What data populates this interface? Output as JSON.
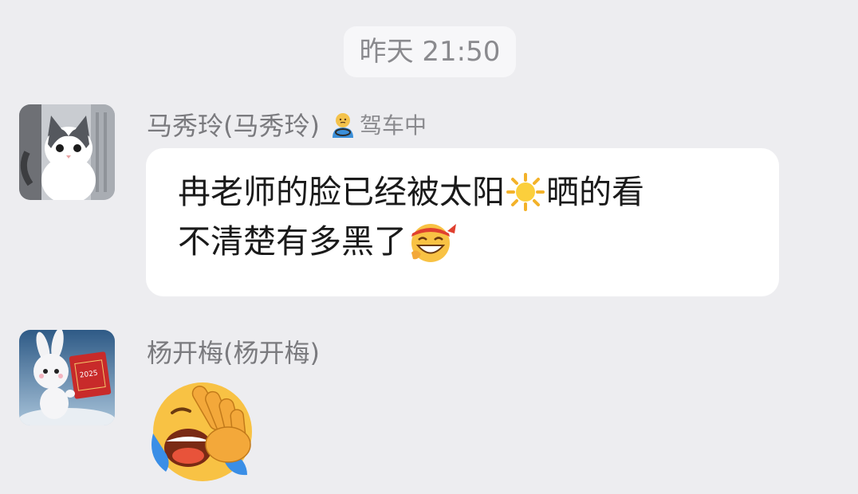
{
  "chat": {
    "timestamp": "昨天 21:50",
    "messages": [
      {
        "sender": "马秀玲(马秀玲)",
        "status": "驾车中",
        "status_icon": "driving-person-icon",
        "avatar": "kitten-avatar",
        "text_line1_a": "冉老师的脸已经被太阳",
        "inline_emoji_1": "sun-emoji",
        "text_line1_b": "晒的看",
        "text_line2": "不清楚有多黑了",
        "inline_emoji_2": "laughing-headband-emoji"
      },
      {
        "sender": "杨开梅(杨开梅)",
        "avatar": "bunny-2025-avatar",
        "avatar_sign_text": "2025",
        "sticker": "loudly-laughing-covering-eyes-emoji"
      }
    ]
  },
  "colors": {
    "background": "#ededf0",
    "bubble": "#ffffff",
    "text": "#1a1a1a",
    "meta_text": "#7a7a7e"
  }
}
